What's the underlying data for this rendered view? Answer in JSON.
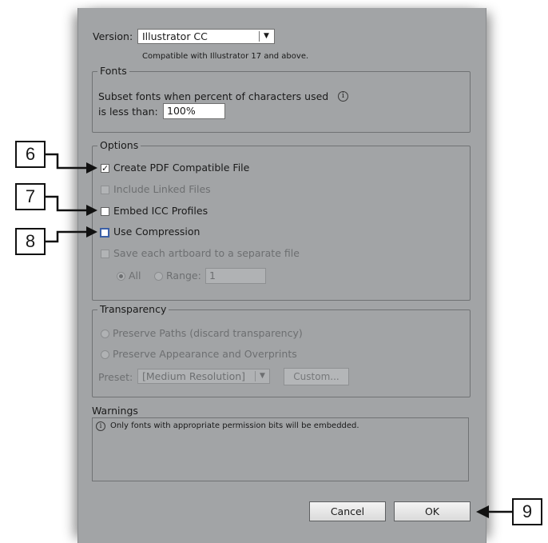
{
  "version": {
    "label": "Version:",
    "selected": "Illustrator CC",
    "note": "Compatible with Illustrator 17 and above."
  },
  "fonts": {
    "legend": "Fonts",
    "subset_line1": "Subset fonts when percent of characters used",
    "subset_line2": "is less than:",
    "percent_value": "100%"
  },
  "options": {
    "legend": "Options",
    "create_pdf": {
      "label": "Create PDF Compatible File",
      "checked": true
    },
    "include_linked": {
      "label": "Include Linked Files",
      "checked": false,
      "enabled": false
    },
    "embed_icc": {
      "label": "Embed ICC Profiles",
      "checked": false
    },
    "use_compression": {
      "label": "Use Compression",
      "checked": false,
      "focused": true
    },
    "save_artboards": {
      "label": "Save each artboard to a separate file",
      "checked": false,
      "enabled": false
    },
    "all_label": "All",
    "range_label": "Range:",
    "range_value": "1"
  },
  "transparency": {
    "legend": "Transparency",
    "preserve_paths": "Preserve Paths (discard transparency)",
    "preserve_appearance": "Preserve Appearance and Overprints",
    "preset_label": "Preset:",
    "preset_value": "[Medium Resolution]",
    "custom_button": "Custom..."
  },
  "warnings": {
    "title": "Warnings",
    "message": "Only fonts with appropriate permission bits will be embedded."
  },
  "buttons": {
    "cancel": "Cancel",
    "ok": "OK"
  },
  "callouts": {
    "c6": "6",
    "c7": "7",
    "c8": "8",
    "c9": "9"
  },
  "colors": {
    "dialog_bg": "#a2a4a6",
    "focus_ring": "#3a5fa6",
    "callout_border": "#111111"
  }
}
